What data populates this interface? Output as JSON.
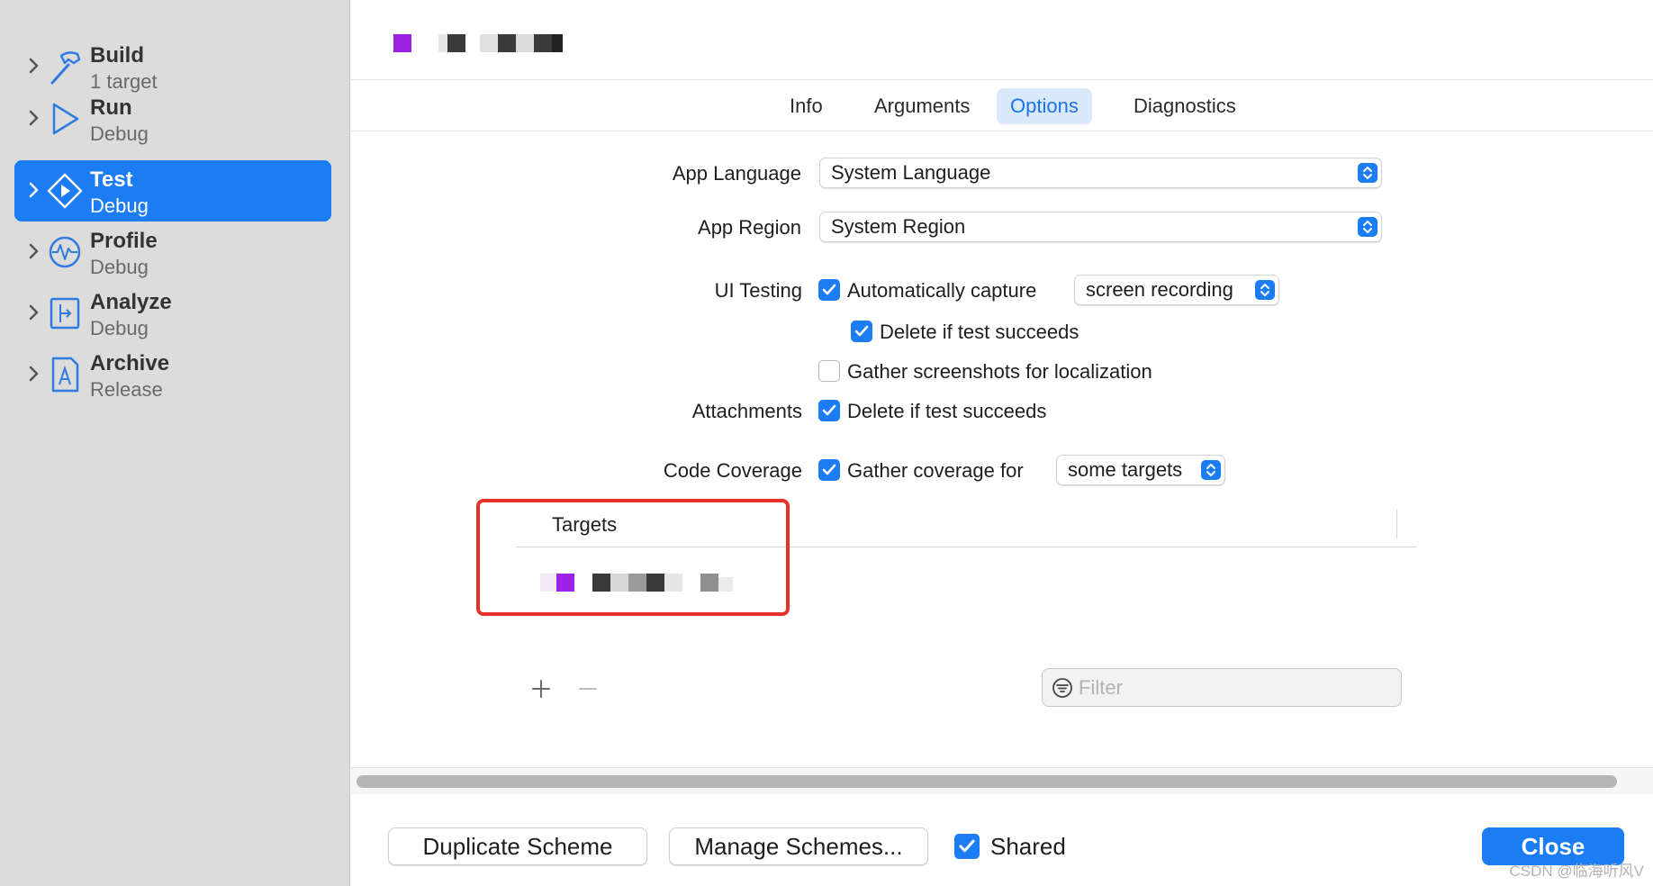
{
  "sidebar": {
    "items": [
      {
        "title": "Build",
        "subtitle": "1 target",
        "icon": "hammer-icon"
      },
      {
        "title": "Run",
        "subtitle": "Debug",
        "icon": "play-icon"
      },
      {
        "title": "Test",
        "subtitle": "Debug",
        "icon": "test-diamond-icon",
        "selected": true
      },
      {
        "title": "Profile",
        "subtitle": "Debug",
        "icon": "waveform-icon"
      },
      {
        "title": "Analyze",
        "subtitle": "Debug",
        "icon": "analyze-icon"
      },
      {
        "title": "Archive",
        "subtitle": "Release",
        "icon": "archive-icon"
      }
    ]
  },
  "tabs": [
    {
      "label": "Info"
    },
    {
      "label": "Arguments"
    },
    {
      "label": "Options",
      "active": true
    },
    {
      "label": "Diagnostics"
    }
  ],
  "form": {
    "app_language": {
      "label": "App Language",
      "value": "System Language"
    },
    "app_region": {
      "label": "App Region",
      "value": "System Region"
    },
    "ui_testing": {
      "label": "UI Testing",
      "auto_capture": "Automatically capture",
      "capture_value": "screen recording",
      "delete_if_succeeds": "Delete if test succeeds",
      "gather_screenshots": "Gather screenshots for localization"
    },
    "attachments": {
      "label": "Attachments",
      "delete_if_succeeds": "Delete if test succeeds"
    },
    "code_coverage": {
      "label": "Code Coverage",
      "gather": "Gather coverage for",
      "targets_value": "some targets"
    }
  },
  "targets_table": {
    "header": "Targets"
  },
  "filter": {
    "placeholder": "Filter"
  },
  "footer": {
    "duplicate": "Duplicate Scheme",
    "manage": "Manage Schemes...",
    "shared": "Shared",
    "close": "Close"
  },
  "watermark": "CSDN @临海听风V",
  "colors": {
    "accent": "#1b7cf3",
    "highlight_box": "#e8312a",
    "sidebar_bg": "#dcdcdc"
  }
}
